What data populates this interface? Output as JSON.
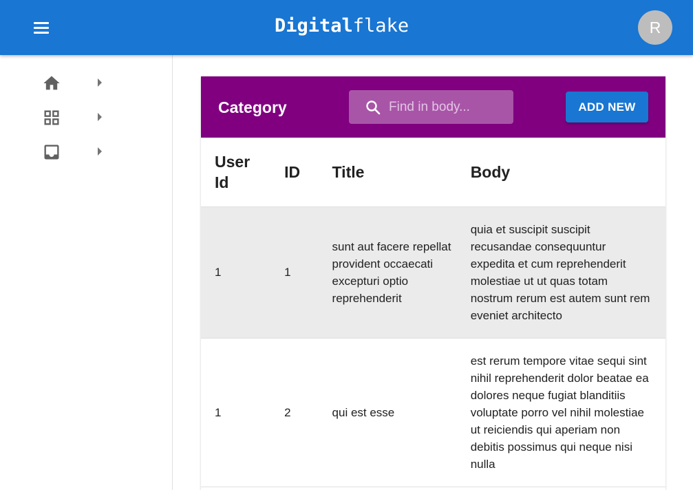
{
  "appbar": {
    "brand_bold": "Digital",
    "brand_light": "flake",
    "avatar_letter": "R"
  },
  "sidebar": {
    "items": [
      {
        "icon": "home-icon"
      },
      {
        "icon": "dashboard-icon"
      },
      {
        "icon": "inbox-icon"
      }
    ]
  },
  "category": {
    "title": "Category",
    "search_placeholder": "Find in body...",
    "add_label": "ADD NEW"
  },
  "table": {
    "headers": [
      "User Id",
      "ID",
      "Title",
      "Body"
    ],
    "rows": [
      {
        "userId": "1",
        "id": "1",
        "title": "sunt aut facere repellat provident occaecati excepturi optio reprehenderit",
        "body": "quia et suscipit suscipit recusandae consequuntur expedita et cum reprehenderit molestiae ut ut quas totam nostrum rerum est autem sunt rem eveniet architecto"
      },
      {
        "userId": "1",
        "id": "2",
        "title": "qui est esse",
        "body": "est rerum tempore vitae sequi sint nihil reprehenderit dolor beatae ea dolores neque fugiat blanditiis voluptate porro vel nihil molestiae ut reiciendis qui aperiam non debitis possimus qui neque nisi nulla"
      }
    ]
  },
  "colors": {
    "appbar": "#1976d2",
    "category_header": "#800080",
    "button": "#1976d2"
  }
}
